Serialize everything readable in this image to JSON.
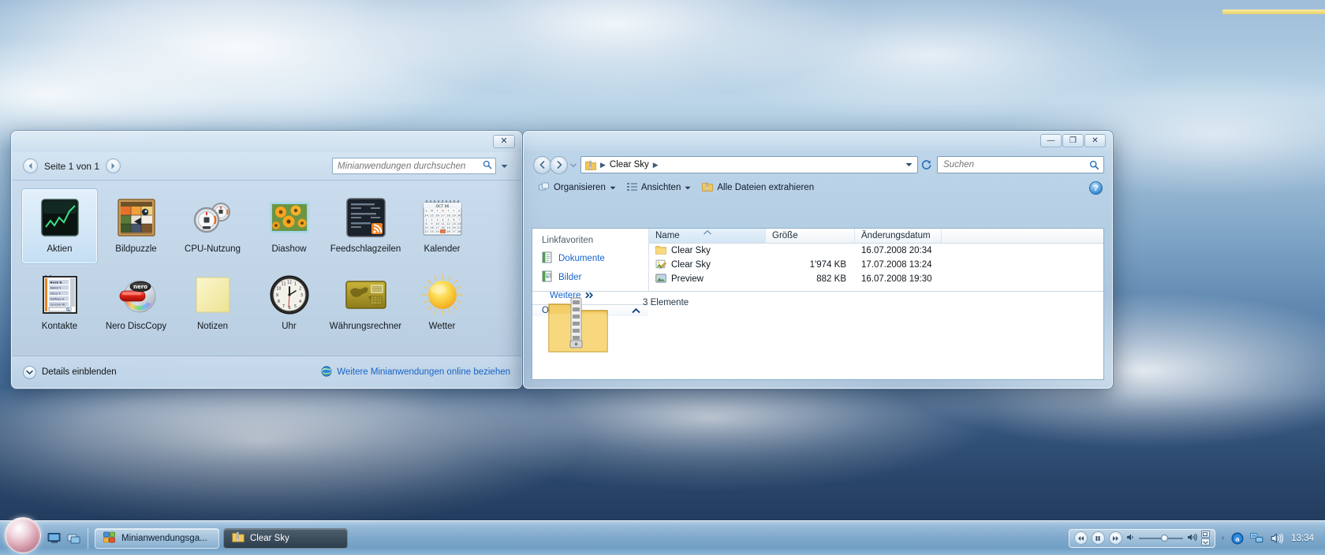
{
  "gadget_gallery": {
    "window_name": "Minianwendungsgalerie",
    "close_label": "✕",
    "pager": {
      "prev_icon": "chevron-left-icon",
      "next_icon": "chevron-right-icon",
      "label": "Seite 1 von 1"
    },
    "search": {
      "placeholder": "Minianwendungen durchsuchen",
      "value": "",
      "icon": "search-icon"
    },
    "gadgets": [
      {
        "label": "Aktien",
        "icon": "stocks-gadget-icon",
        "selected": true
      },
      {
        "label": "Bildpuzzle",
        "icon": "picture-puzzle-gadget-icon",
        "selected": false
      },
      {
        "label": "CPU-Nutzung",
        "icon": "cpu-meter-gadget-icon",
        "selected": false
      },
      {
        "label": "Diashow",
        "icon": "slideshow-gadget-icon",
        "selected": false
      },
      {
        "label": "Feedschlagzeilen",
        "icon": "feed-headlines-gadget-icon",
        "selected": false
      },
      {
        "label": "Kalender",
        "icon": "calendar-gadget-icon",
        "selected": false
      },
      {
        "label": "Kontakte",
        "icon": "contacts-gadget-icon",
        "selected": false
      },
      {
        "label": "Nero DiscCopy",
        "icon": "nero-disccopy-gadget-icon",
        "selected": false
      },
      {
        "label": "Notizen",
        "icon": "notes-gadget-icon",
        "selected": false
      },
      {
        "label": "Uhr",
        "icon": "clock-gadget-icon",
        "selected": false
      },
      {
        "label": "Währungsrechner",
        "icon": "currency-gadget-icon",
        "selected": false
      },
      {
        "label": "Wetter",
        "icon": "weather-gadget-icon",
        "selected": false
      }
    ],
    "footer": {
      "details_label": "Details einblenden",
      "details_icon": "chevron-down-icon",
      "online_label": "Weitere Minianwendungen online beziehen",
      "online_icon": "globe-icon"
    },
    "calendar_icon": {
      "month": "OCT 06",
      "weekdays": [
        "S",
        "M",
        "T",
        "W",
        "T",
        "F",
        "S"
      ]
    }
  },
  "explorer": {
    "window_name": "Clear Sky",
    "titlebar": {
      "minimize": "—",
      "maximize": "❐",
      "close": "✕"
    },
    "nav": {
      "back_icon": "back-arrow-icon",
      "forward_icon": "forward-arrow-icon",
      "history_icon": "history-caret-icon"
    },
    "address": {
      "folder_icon": "zip-folder-icon",
      "crumbs": [
        "Clear Sky"
      ],
      "dropdown_icon": "chevron-down-icon",
      "refresh_icon": "refresh-icon"
    },
    "search": {
      "placeholder": "Suchen",
      "value": "",
      "icon": "search-icon"
    },
    "toolbar": {
      "organize": "Organisieren",
      "organize_icon": "organize-icon",
      "views": "Ansichten",
      "views_icon": "views-icon",
      "extract": "Alle Dateien extrahieren",
      "extract_icon": "extract-icon",
      "help_icon": "help-icon",
      "help_label": "?"
    },
    "sidebar": {
      "title": "Linkfavoriten",
      "items": [
        {
          "label": "Dokumente",
          "icon": "documents-icon"
        },
        {
          "label": "Bilder",
          "icon": "pictures-icon"
        }
      ],
      "more_label": "Weitere",
      "more_icon": "double-chevron-right-icon",
      "folders_label": "Ordner",
      "folders_icon": "chevron-up-icon"
    },
    "columns": [
      {
        "label": "Name",
        "sorted": true,
        "sort_icon": "sort-asc-icon"
      },
      {
        "label": "Größe",
        "sorted": false
      },
      {
        "label": "Änderungsdatum",
        "sorted": false
      },
      {
        "label": "",
        "sorted": false
      }
    ],
    "rows": [
      {
        "name": "Clear Sky",
        "icon": "folder-icon",
        "size": "",
        "date": "16.07.2008 20:34"
      },
      {
        "name": "Clear Sky",
        "icon": "theme-icon",
        "size": "1'974 KB",
        "date": "17.07.2008 13:24"
      },
      {
        "name": "Preview",
        "icon": "image-icon",
        "size": "882 KB",
        "date": "16.07.2008 19:30"
      }
    ],
    "status": {
      "count_label": "3 Elemente",
      "folder_icon": "large-zip-folder-icon"
    }
  },
  "taskbar": {
    "start_label": "start-orb",
    "quick_launch": [
      {
        "name": "show-desktop-icon"
      },
      {
        "name": "switch-windows-icon"
      }
    ],
    "tasks": [
      {
        "label": "Minianwendungsga...",
        "icon": "gadget-gallery-icon",
        "active": false
      },
      {
        "label": "Clear Sky",
        "icon": "zip-folder-icon",
        "active": true
      }
    ],
    "tray": {
      "media": {
        "prev_icon": "media-prev-icon",
        "pause_icon": "media-pause-icon",
        "next_icon": "media-next-icon",
        "vol_low_icon": "speaker-low-icon",
        "vol_high_icon": "speaker-high-icon"
      },
      "icons": [
        {
          "name": "overflow-arrow-icon",
          "glyph": "‹"
        },
        {
          "name": "antivirus-icon"
        },
        {
          "name": "network-icon"
        },
        {
          "name": "volume-icon"
        }
      ],
      "clock": "13:34"
    }
  }
}
